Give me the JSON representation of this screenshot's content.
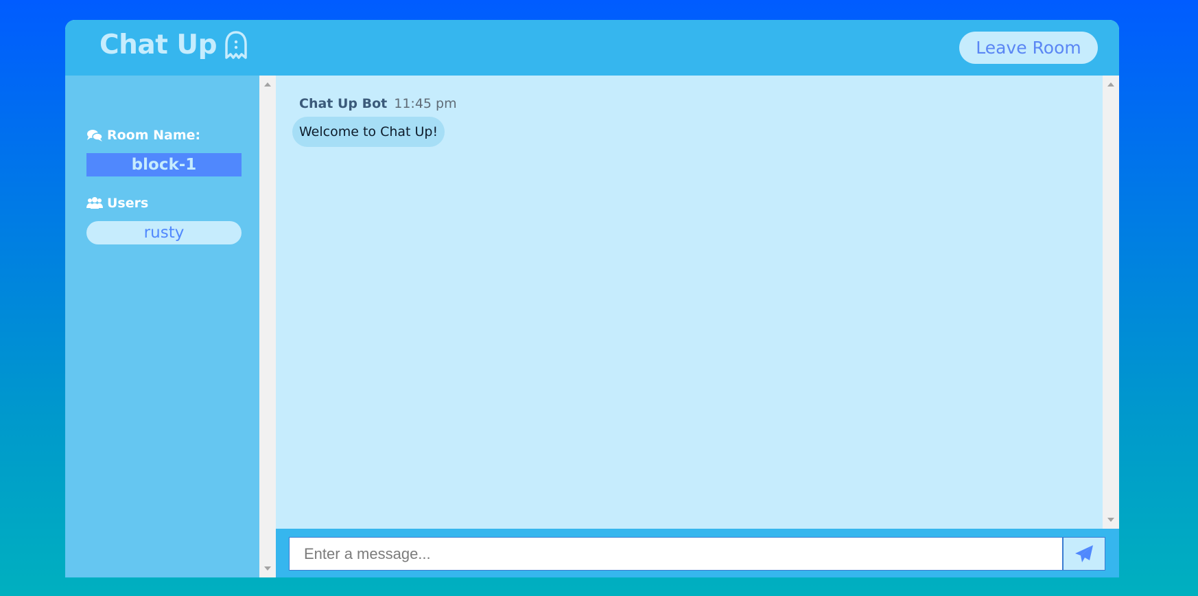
{
  "header": {
    "title": "Chat Up",
    "logo_icon": "ghost-icon",
    "leave_label": "Leave Room"
  },
  "sidebar": {
    "room_heading": "Room Name:",
    "room_icon": "comments-icon",
    "room_name": "block-1",
    "users_heading": "Users",
    "users_icon": "users-icon",
    "users": [
      "rusty"
    ]
  },
  "messages": [
    {
      "author": "Chat Up Bot",
      "time": "11:45 pm",
      "text": "Welcome to Chat Up!"
    }
  ],
  "composer": {
    "placeholder": "Enter a message...",
    "send_icon": "paper-plane-icon"
  },
  "colors": {
    "header_bg": "#36b6ee",
    "sidebar_bg": "#65c6f1",
    "chat_bg": "#c6ecfd",
    "accent": "#5088fd"
  }
}
